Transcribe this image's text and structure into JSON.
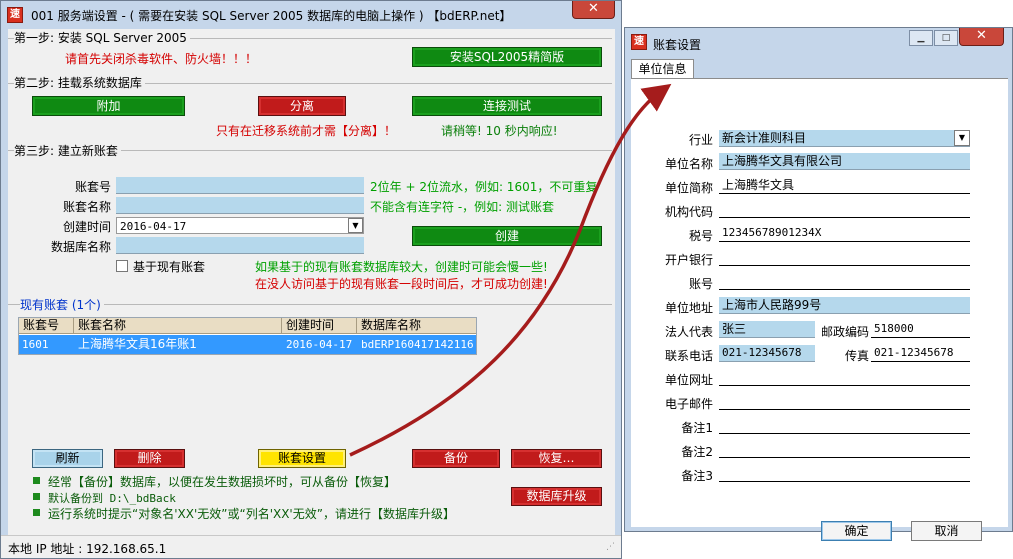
{
  "service_window": {
    "title": "001 服务端设置 - ( 需要在安装 SQL Server 2005 数据库的电脑上操作 ) 【bdERP.net】",
    "app_icon_char": "速",
    "close_glyph": "✕",
    "step1": {
      "title": "第一步: 安装 SQL Server 2005",
      "warning": "请首先关闭杀毒软件、防火墙！！！",
      "install_button": "安装SQL2005精简版"
    },
    "step2": {
      "title": "第二步: 挂载系统数据库",
      "attach_button": "附加",
      "detach_button": "分离",
      "test_button": "连接测试",
      "detach_note": "只有在迁移系统前才需【分离】！",
      "wait_note": "请稍等! 10 秒内响应!"
    },
    "step3": {
      "title": "第三步: 建立新账套",
      "account_no_label": "账套号",
      "account_no_value": "",
      "account_no_hint": "2位年 + 2位流水，例如: 1601，不可重复",
      "account_name_label": "账套名称",
      "account_name_value": "",
      "account_name_hint": "不能含有连字符 -，例如: 测试账套",
      "created_label": "创建时间",
      "created_value": "2016-04-17",
      "db_name_label": "数据库名称",
      "db_name_value": "",
      "create_button": "创建",
      "based_on_label": "基于现有账套",
      "based_on_checked": false,
      "based_note_1": "如果基于的现有账套数据库较大，创建时可能会慢一些!",
      "based_note_2": "在没人访问基于的现有账套一段时间后，才可成功创建!"
    },
    "existing": {
      "title": "现有账套 (1个)",
      "columns": [
        "账套号",
        "账套名称",
        "创建时间",
        "数据库名称"
      ],
      "rows": [
        [
          "1601",
          "上海腾华文具16年账1",
          "2016-04-17",
          "bdERP160417142116"
        ]
      ]
    },
    "buttons": {
      "refresh": "刷新",
      "delete": "删除",
      "account_settings": "账套设置",
      "backup": "备份",
      "restore": "恢复…",
      "upgrade": "数据库升级"
    },
    "tips": [
      "经常【备份】数据库，以便在发生数据损坏时，可从备份【恢复】",
      "默认备份到 D:\\_bdBack",
      "运行系统时提示“对象名'XX'无效”或“列名'XX'无效”，请进行【数据库升级】"
    ],
    "status": "本地 IP 地址 : 192.168.65.1"
  },
  "account_window": {
    "title": "账套设置",
    "app_icon_char": "速",
    "min_glyph": "▁",
    "max_glyph": "□",
    "close_glyph": "✕",
    "tab": "单位信息",
    "fields": {
      "industry_label": "行业",
      "industry_value": "新会计准则科目",
      "unit_name_label": "单位名称",
      "unit_name_value": "上海腾华文具有限公司",
      "unit_short_label": "单位简称",
      "unit_short_value": "上海腾华文具",
      "org_code_label": "机构代码",
      "org_code_value": "",
      "tax_no_label": "税号",
      "tax_no_value": "12345678901234X",
      "bank_label": "开户银行",
      "bank_value": "",
      "account_label": "账号",
      "account_value": "",
      "address_label": "单位地址",
      "address_value": "上海市人民路99号",
      "legal_label": "法人代表",
      "legal_value": "张三",
      "postcode_label": "邮政编码",
      "postcode_value": "518000",
      "phone_label": "联系电话",
      "phone_value": "021-12345678",
      "fax_label": "传真",
      "fax_value": "021-12345678",
      "website_label": "单位网址",
      "website_value": "",
      "email_label": "电子邮件",
      "email_value": "",
      "note1_label": "备注1",
      "note1_value": "",
      "note2_label": "备注2",
      "note2_value": "",
      "note3_label": "备注3",
      "note3_value": ""
    },
    "ok_button": "确定",
    "cancel_button": "取消"
  },
  "colors": {
    "green_button": "#0f8a12",
    "red_button": "#c11b1b",
    "yellow_button": "#ffe400",
    "light_blue": "#b5d8ec",
    "selection": "#3399ff",
    "arrow": "#a51c1c"
  }
}
